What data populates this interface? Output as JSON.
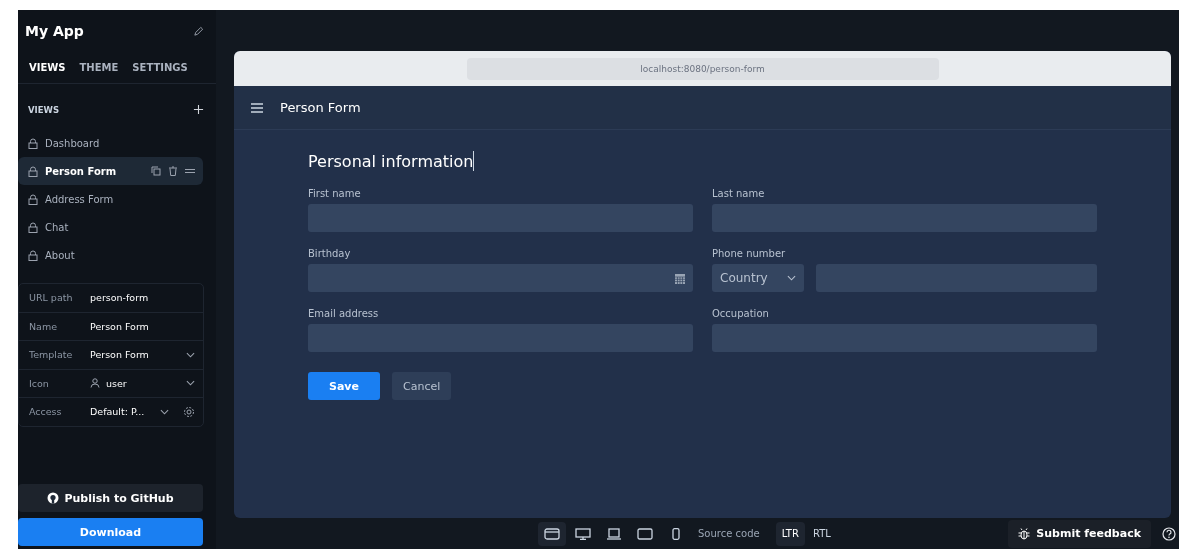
{
  "app": {
    "title": "My App"
  },
  "tabs": [
    {
      "label": "VIEWS",
      "selected": true
    },
    {
      "label": "THEME",
      "selected": false
    },
    {
      "label": "SETTINGS",
      "selected": false
    }
  ],
  "views_heading": "VIEWS",
  "views": [
    {
      "label": "Dashboard",
      "selected": false
    },
    {
      "label": "Person Form",
      "selected": true
    },
    {
      "label": "Address Form",
      "selected": false
    },
    {
      "label": "Chat",
      "selected": false
    },
    {
      "label": "About",
      "selected": false
    }
  ],
  "properties": [
    {
      "kind": "text",
      "label": "URL path",
      "value": "person-form"
    },
    {
      "kind": "text",
      "label": "Name",
      "value": "Person Form"
    },
    {
      "kind": "select",
      "label": "Template",
      "value": "Person Form"
    },
    {
      "kind": "icon-select",
      "label": "Icon",
      "value": "user"
    },
    {
      "kind": "select-settings",
      "label": "Access",
      "value": "Default: P..."
    }
  ],
  "actions": {
    "publish": "Publish to GitHub",
    "download": "Download"
  },
  "preview": {
    "url": "localhost:8080/person-form",
    "page_title": "Person Form",
    "form_title": "Personal information",
    "fields": [
      {
        "kind": "text",
        "label": "First name"
      },
      {
        "kind": "text",
        "label": "Last name"
      },
      {
        "kind": "date",
        "label": "Birthday"
      },
      {
        "kind": "phone",
        "label": "Phone number",
        "placeholder": "Country"
      },
      {
        "kind": "text",
        "label": "Email address"
      },
      {
        "kind": "text",
        "label": "Occupation"
      }
    ],
    "buttons": [
      {
        "kind": "primary",
        "label": "Save"
      },
      {
        "kind": "secondary",
        "label": "Cancel"
      }
    ]
  },
  "toolbar": {
    "devices": [
      {
        "kind": "window",
        "selected": true
      },
      {
        "kind": "desktop",
        "selected": false
      },
      {
        "kind": "laptop",
        "selected": false
      },
      {
        "kind": "tablet",
        "selected": false
      },
      {
        "kind": "phone",
        "selected": false
      }
    ],
    "source_code": "Source code",
    "directions": [
      {
        "label": "LTR",
        "selected": true
      },
      {
        "label": "RTL",
        "selected": false
      }
    ],
    "feedback": "Submit feedback"
  }
}
